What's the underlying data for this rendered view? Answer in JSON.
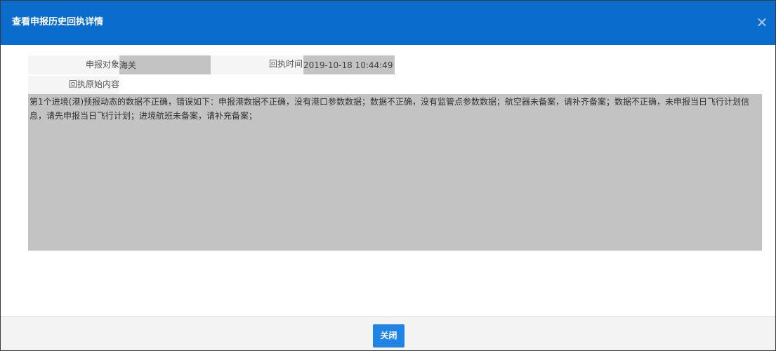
{
  "dialog": {
    "title": "查看申报历史回执详情",
    "close_icon": "close-icon",
    "close_glyph": "✕"
  },
  "fields": {
    "declare_target_label": "申报对象",
    "declare_target_value": "海关",
    "receipt_time_label": "回执时间",
    "receipt_time_value": "2019-10-18 10:44:49",
    "raw_content_label": "回执原始内容",
    "raw_content_value": "第1个进境(港)预报动态的数据不正确，错误如下：申报港数据不正确，没有港口参数数据；数据不正确，没有监管点参数数据；航空器未备案，请补齐备案；数据不正确，未申报当日飞行计划信息，请先申报当日飞行计划；进境航班未备案，请补充备案；"
  },
  "footer": {
    "close_button_label": "关闭"
  },
  "colors": {
    "titlebar": "#0a6ccc",
    "value_background": "#c3c3c3",
    "button": "#1f84e6"
  }
}
